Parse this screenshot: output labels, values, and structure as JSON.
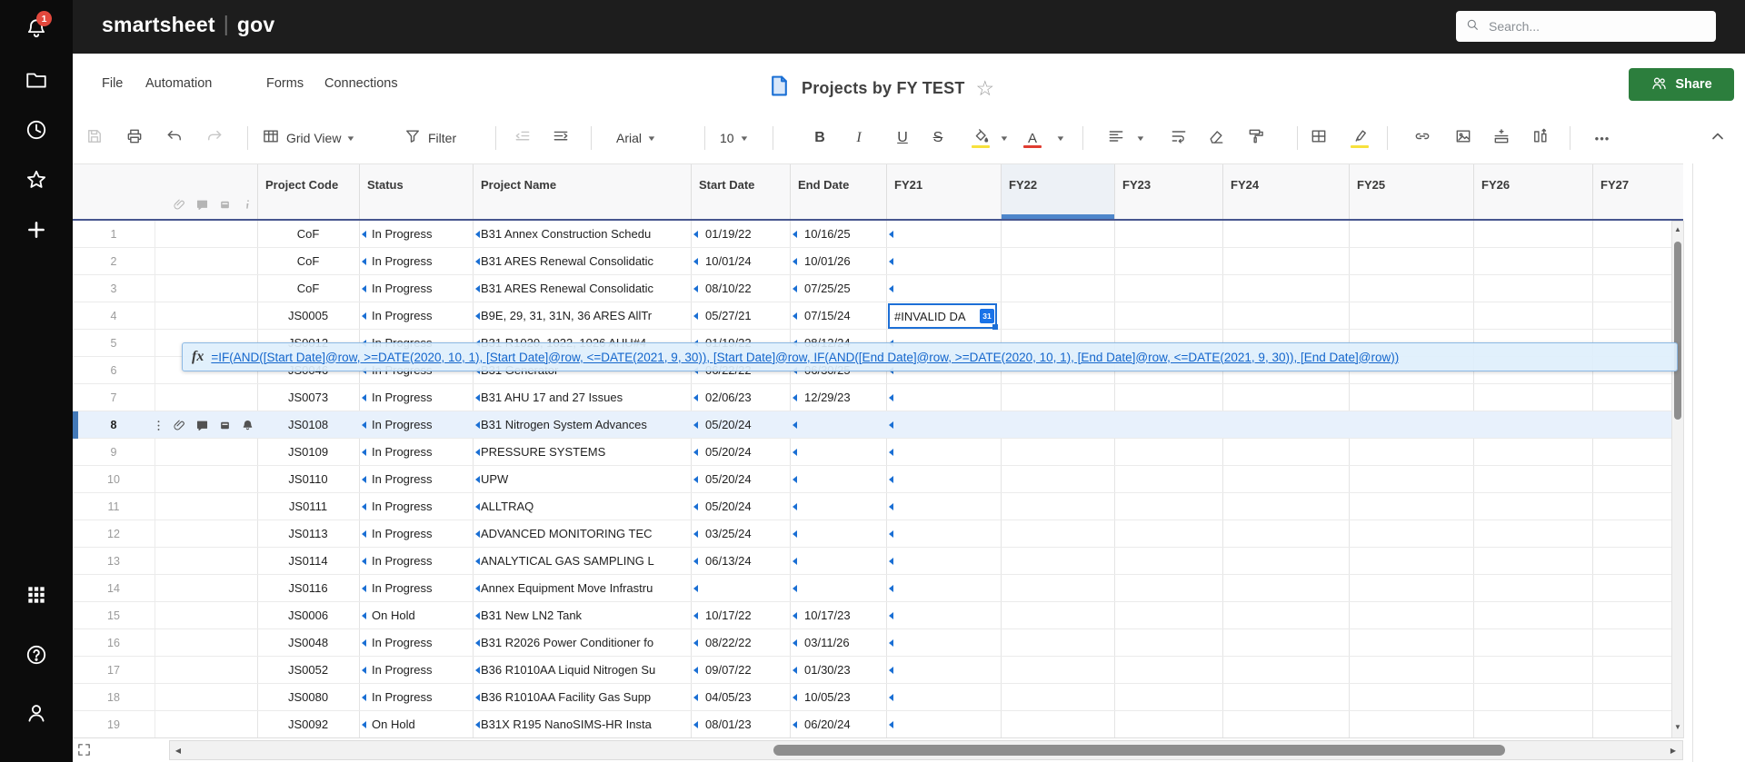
{
  "topbar": {
    "logo_primary": "smartsheet",
    "logo_divider": "|",
    "logo_secondary": "gov",
    "search_placeholder": "Search...",
    "notification_badge": "1"
  },
  "left_rail": {
    "icons": [
      "notifications-bell",
      "browse-folder",
      "recents-clock",
      "favorites-star",
      "create-plus",
      "app-launcher",
      "help",
      "account"
    ]
  },
  "menu_bar": {
    "items": [
      "File",
      "Automation",
      "Forms",
      "Connections"
    ]
  },
  "title_bar": {
    "title": "Projects by FY TEST"
  },
  "share_button": {
    "label": "Share"
  },
  "toolbar": {
    "view_label": "Grid View",
    "filter_label": "Filter",
    "font_family": "Arial",
    "font_size": "10",
    "bold_label": "B",
    "italic_label": "I",
    "underline_label": "U",
    "strikethrough_label": "S",
    "text_color_label": "A",
    "more_label": "•••"
  },
  "grid": {
    "columns": [
      "Project Code",
      "Status",
      "Project Name",
      "Start Date",
      "End Date",
      "FY21",
      "FY22",
      "FY23",
      "FY24",
      "FY25",
      "FY26",
      "FY27"
    ],
    "selected_column": "FY22",
    "selected_row": "8",
    "rows": [
      {
        "num": "1",
        "code": "CoF",
        "status": "In Progress",
        "name": "B31 Annex Construction Schedu",
        "start": "01/19/22",
        "end": "10/16/25",
        "fy27_overflow": true
      },
      {
        "num": "2",
        "code": "CoF",
        "status": "In Progress",
        "name": "B31 ARES Renewal Consolidatic",
        "start": "10/01/24",
        "end": "10/01/26"
      },
      {
        "num": "3",
        "code": "CoF",
        "status": "In Progress",
        "name": "B31 ARES Renewal Consolidatic",
        "start": "08/10/22",
        "end": "07/25/25"
      },
      {
        "num": "4",
        "code": "JS0005",
        "status": "In Progress",
        "name": "B9E, 29, 31, 31N, 36 ARES AllTr",
        "start": "05/27/21",
        "end": "07/15/24",
        "fy27_overflow": true
      },
      {
        "num": "5",
        "code": "JS0012",
        "status": "In Progress",
        "name": "B31 R1020, 1022, 1026 AHU#4",
        "start": "01/19/22",
        "end": "08/12/24"
      },
      {
        "num": "6",
        "code": "JS0046",
        "status": "In Progress",
        "name": "B31 Generator",
        "start": "06/22/22",
        "end": "06/30/25"
      },
      {
        "num": "7",
        "code": "JS0073",
        "status": "In Progress",
        "name": "B31 AHU 17 and 27 Issues",
        "start": "02/06/23",
        "end": "12/29/23"
      },
      {
        "num": "8",
        "code": "JS0108",
        "status": "In Progress",
        "name": "B31 Nitrogen System Advances",
        "start": "05/20/24",
        "end": "",
        "selected": true
      },
      {
        "num": "9",
        "code": "JS0109",
        "status": "In Progress",
        "name": "PRESSURE SYSTEMS",
        "start": "05/20/24",
        "end": ""
      },
      {
        "num": "10",
        "code": "JS0110",
        "status": "In Progress",
        "name": "UPW",
        "start": "05/20/24",
        "end": ""
      },
      {
        "num": "11",
        "code": "JS0111",
        "status": "In Progress",
        "name": "ALLTRAQ",
        "start": "05/20/24",
        "end": ""
      },
      {
        "num": "12",
        "code": "JS0113",
        "status": "In Progress",
        "name": "ADVANCED MONITORING TEC",
        "start": "03/25/24",
        "end": ""
      },
      {
        "num": "13",
        "code": "JS0114",
        "status": "In Progress",
        "name": "ANALYTICAL GAS SAMPLING L",
        "start": "06/13/24",
        "end": ""
      },
      {
        "num": "14",
        "code": "JS0116",
        "status": "In Progress",
        "name": "Annex Equipment Move Infrastru",
        "start": "",
        "end": ""
      },
      {
        "num": "15",
        "code": "JS0006",
        "status": "On Hold",
        "name": "B31 New LN2 Tank",
        "start": "10/17/22",
        "end": "10/17/23"
      },
      {
        "num": "16",
        "code": "JS0048",
        "status": "In Progress",
        "name": "B31 R2026 Power Conditioner fo",
        "start": "08/22/22",
        "end": "03/11/26"
      },
      {
        "num": "17",
        "code": "JS0052",
        "status": "In Progress",
        "name": "B36 R1010AA Liquid Nitrogen Su",
        "start": "09/07/22",
        "end": "01/30/23"
      },
      {
        "num": "18",
        "code": "JS0080",
        "status": "In Progress",
        "name": "B36 R1010AA Facility Gas Supp",
        "start": "04/05/23",
        "end": "10/05/23"
      },
      {
        "num": "19",
        "code": "JS0092",
        "status": "On Hold",
        "name": "B31X R195 NanoSIMS-HR Insta",
        "start": "08/01/23",
        "end": "06/20/24"
      }
    ],
    "invalid_cell": {
      "row": "4",
      "column": "FY21",
      "value": "#INVALID DA",
      "calendar_badge": "31"
    },
    "formula_tooltip": {
      "fx_label": "fx",
      "formula": "=IF(AND([Start Date]@row, >=DATE(2020, 10, 1), [Start Date]@row, <=DATE(2021, 9, 30)), [Start Date]@row, IF(AND([End Date]@row, >=DATE(2020, 10, 1), [End Date]@row, <=DATE(2021, 9, 30)), [End Date]@row))"
    }
  },
  "right_rail": {
    "icons": [
      "conversations",
      "attachments",
      "proofs",
      "update-requests",
      "publish",
      "activity-log",
      "sheet-summary"
    ]
  },
  "colors": {
    "accent_blue": "#1a6fd4",
    "selected_row_highlight": "#e8f1fc",
    "selected_row_bar": "#4379b8",
    "header_underline_navy": "#47568f",
    "fy22_selected_bar": "#4e86cb",
    "share_green": "#2c7e3d",
    "notification_badge_red": "#e2483d",
    "tooltip_bg": "#ddeffc",
    "formula_text_blue": "#1466cc",
    "fill_highlight_yellow": "#f7e13c",
    "text_color_red": "#e03c31",
    "invalid_cell_border": "#1d6fd6"
  }
}
